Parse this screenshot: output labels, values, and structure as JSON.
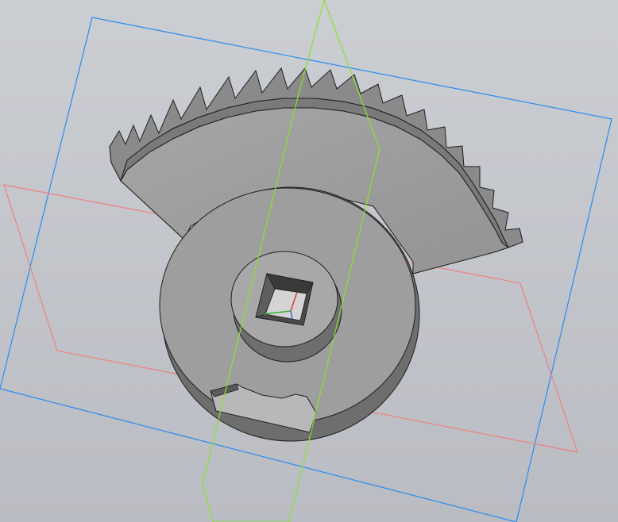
{
  "viewport": {
    "background_top": "#cbced3",
    "background_bottom": "#b9bcc2"
  },
  "planes": {
    "blue_plane_color": "#2a8cf0",
    "red_plane_color": "#f08080",
    "green_plane_color": "#8be22a"
  },
  "part": {
    "face_color": "#9c9c9c",
    "side_color": "#6e6e6e",
    "edge_color": "#1e1e1e"
  },
  "axis_triad": {
    "x_color": "#e03030",
    "y_color": "#30b030",
    "z_color": "#3060e0"
  }
}
